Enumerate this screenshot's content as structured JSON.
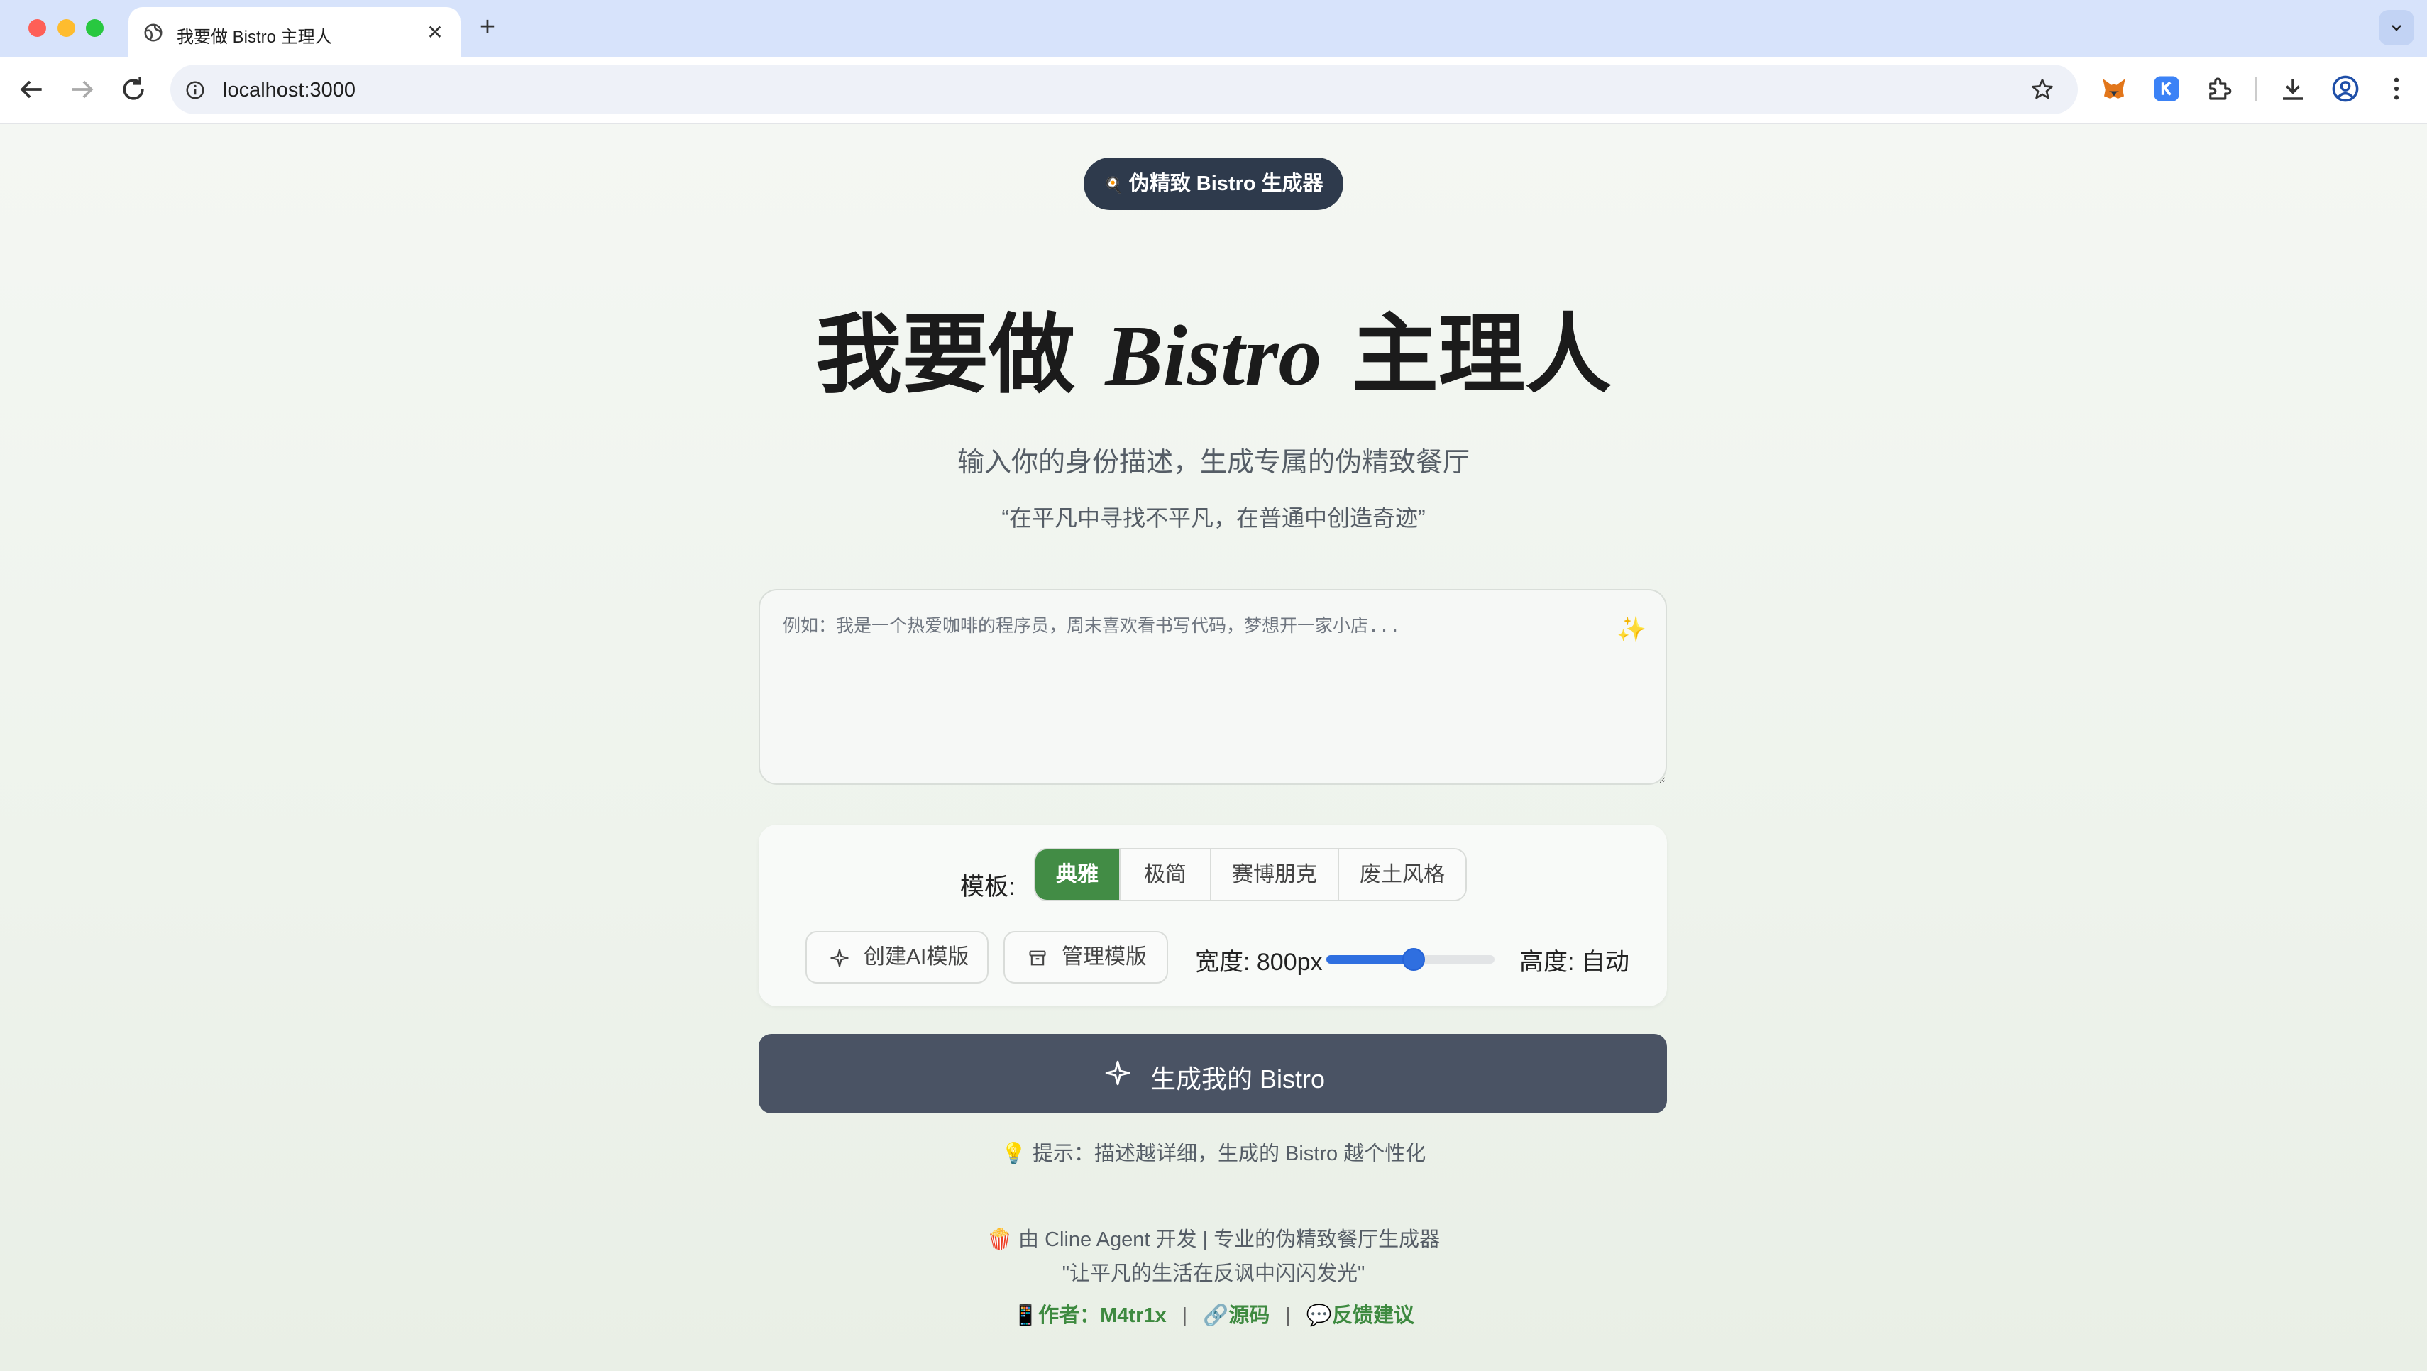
{
  "browser": {
    "tab_title": "我要做 Bistro 主理人",
    "tab_close": "✕",
    "new_tab": "+",
    "url": "localhost:3000"
  },
  "header": {
    "badge_icon": "🍳",
    "badge_label": "伪精致 Bistro 生成器"
  },
  "hero": {
    "title_prefix": "我要做",
    "title_brand": "Bistro",
    "title_suffix": "主理人",
    "subtitle": "输入你的身份描述，生成专属的伪精致餐厅",
    "quote": "“在平凡中寻找不平凡，在普通中创造奇迹”"
  },
  "input": {
    "placeholder": "例如：我是一个热爱咖啡的程序员，周末喜欢看书写代码，梦想开一家小店...",
    "value": "",
    "sparkle_icon": "✨"
  },
  "settings": {
    "template_label": "模板:",
    "templates": [
      {
        "label": "典雅",
        "active": true
      },
      {
        "label": "极简",
        "active": false
      },
      {
        "label": "赛博朋克",
        "active": false
      },
      {
        "label": "废土风格",
        "active": false
      }
    ],
    "create_ai_template": "创建AI模版",
    "manage_templates": "管理模版",
    "width_label": "宽度: 800px",
    "width_slider_fraction": 0.52,
    "height_label": "高度: 自动"
  },
  "generate_button": "生成我的 Bistro",
  "tip": "💡 提示：描述越详细，生成的 Bistro 越个性化",
  "footer": {
    "line1": "🍿 由 Cline Agent 开发 | 专业的伪精致餐厅生成器",
    "line2": "\"让平凡的生活在反讽中闪闪发光\"",
    "author_icon": "📱",
    "author": "作者：M4tr1x",
    "source_icon": "🔗",
    "source": "源码",
    "feedback_icon": "💬",
    "feedback": "反馈建议",
    "separator": "|"
  },
  "colors": {
    "accent_green": "#428c45",
    "button_dark": "#4a5364",
    "badge_dark": "#2e3a4c",
    "slider_blue": "#2f6fe0"
  }
}
